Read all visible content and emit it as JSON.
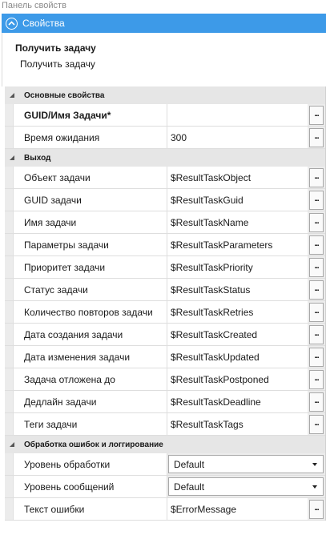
{
  "panel_caption": "Панель свойств",
  "header": {
    "title": "Свойства",
    "collapse_icon": "chevron-up-circle-icon"
  },
  "task": {
    "title": "Получить задачу",
    "subtitle": "Получить задачу"
  },
  "sections": {
    "main": {
      "label": "Основные свойства",
      "rows": [
        {
          "name": "GUID/Имя Задачи*",
          "value": ""
        },
        {
          "name": "Время ожидания",
          "value": "300"
        }
      ]
    },
    "output": {
      "label": "Выход",
      "rows": [
        {
          "name": "Объект задачи",
          "value": "$ResultTaskObject"
        },
        {
          "name": "GUID задачи",
          "value": "$ResultTaskGuid"
        },
        {
          "name": "Имя задачи",
          "value": "$ResultTaskName"
        },
        {
          "name": "Параметры задачи",
          "value": "$ResultTaskParameters"
        },
        {
          "name": "Приоритет задачи",
          "value": "$ResultTaskPriority"
        },
        {
          "name": "Статус задачи",
          "value": "$ResultTaskStatus"
        },
        {
          "name": "Количество повторов задачи",
          "value": "$ResultTaskRetries"
        },
        {
          "name": "Дата создания задачи",
          "value": "$ResultTaskCreated"
        },
        {
          "name": "Дата изменения задачи",
          "value": "$ResultTaskUpdated"
        },
        {
          "name": "Задача отложена до",
          "value": "$ResultTaskPostponed"
        },
        {
          "name": "Дедлайн задачи",
          "value": "$ResultTaskDeadline"
        },
        {
          "name": "Теги задачи",
          "value": "$ResultTaskTags"
        }
      ]
    },
    "errors": {
      "label": "Обработка ошибок и логгирование",
      "rows": [
        {
          "name": "Уровень обработки",
          "value": "Default"
        },
        {
          "name": "Уровень сообщений",
          "value": "Default"
        },
        {
          "name": "Текст ошибки",
          "value": "$ErrorMessage"
        }
      ]
    }
  },
  "ellipsis_label": "...",
  "colors": {
    "header_bg": "#3d9ae8",
    "category_bg": "#e6e6e6"
  }
}
